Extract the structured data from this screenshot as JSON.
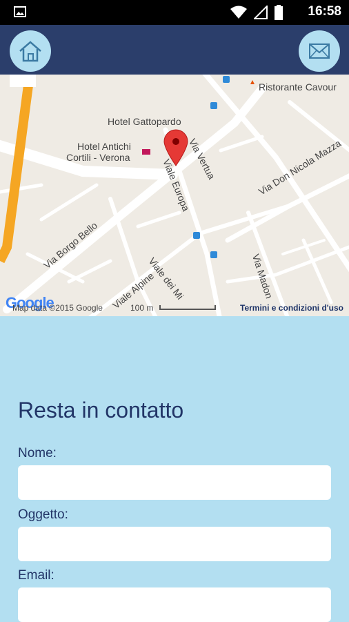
{
  "status_bar": {
    "time": "16:58"
  },
  "app_bar": {
    "home_icon": "home-icon",
    "mail_icon": "mail-icon"
  },
  "map": {
    "labels": {
      "ristorante": "Ristorante Cavour",
      "hotel_gattopardo": "Hotel Gattopardo",
      "hotel_antichi_1": "Hotel Antichi",
      "hotel_antichi_2": "Cortili - Verona",
      "via_vertua": "Via Vertua",
      "via_don_nicola": "Via Don Nicola Mazza",
      "viale_europa": "Viale Europa",
      "via_borgo_bello": "Via Borgo Bello",
      "viale_dei_mi": "Viale dei Mi",
      "viale_alpine": "Viale Alpine",
      "via_madon": "Via Madon"
    },
    "google": "Google",
    "map_data": "Map data ©2015 Google",
    "scale": "100 m",
    "terms": "Termini e condizioni d'uso"
  },
  "form": {
    "title": "Resta in contatto",
    "name_label": "Nome:",
    "name_value": "",
    "subject_label": "Oggetto:",
    "subject_value": "",
    "email_label": "Email:",
    "email_value": ""
  }
}
